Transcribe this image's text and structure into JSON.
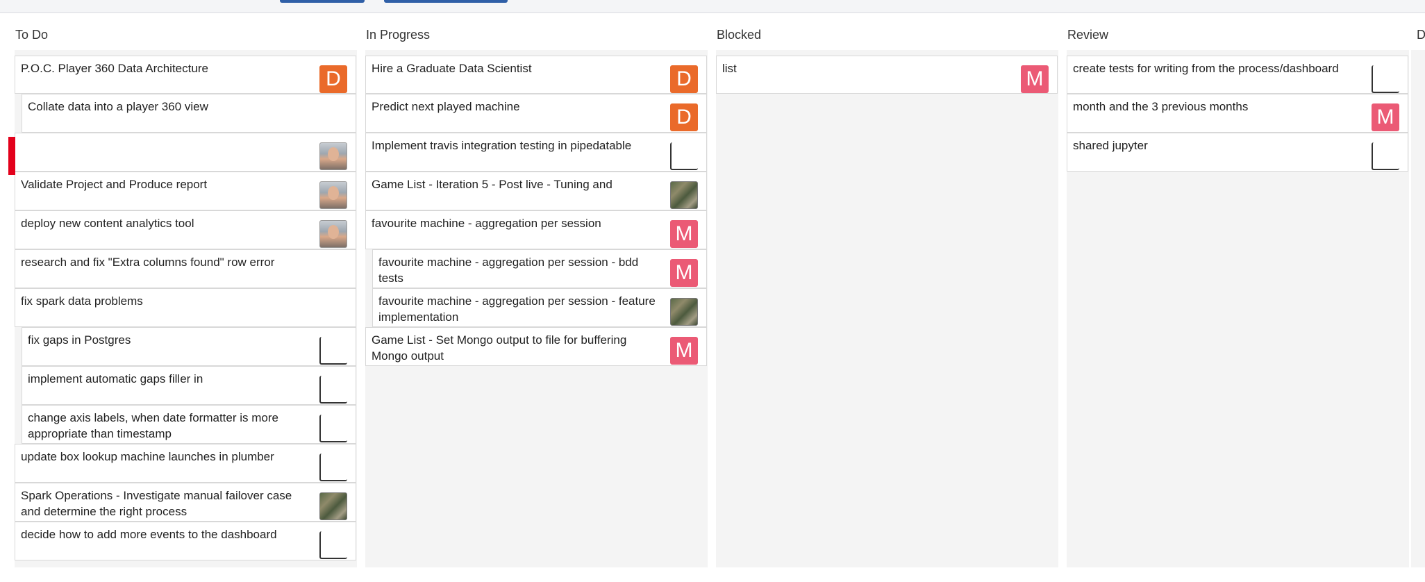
{
  "board": {
    "columns": [
      {
        "title": "To Do",
        "cards": [
          {
            "title": "P.O.C. Player 360 Data Architecture",
            "avatar": "D",
            "avatar_type": "letter-orange"
          },
          {
            "title": "Collate data into a player 360 view",
            "avatar": "",
            "avatar_type": "none"
          },
          {
            "title": "",
            "avatar": "",
            "avatar_type": "photo"
          },
          {
            "title": "Validate Project and Produce report",
            "avatar": "",
            "avatar_type": "photo"
          },
          {
            "title": "deploy new content analytics tool",
            "avatar": "",
            "avatar_type": "photo"
          },
          {
            "title": "research and fix \"Extra columns found\" row error",
            "avatar": "",
            "avatar_type": "none"
          },
          {
            "title": "fix spark data problems",
            "avatar": "",
            "avatar_type": "none"
          },
          {
            "title": "fix gaps in Postgres",
            "avatar": "",
            "avatar_type": "partial"
          },
          {
            "title": "implement automatic gaps filler in",
            "avatar": "",
            "avatar_type": "partial"
          },
          {
            "title": "change axis labels, when date formatter is more appropriate than timestamp",
            "avatar": "",
            "avatar_type": "partial"
          },
          {
            "title": "update box lookup machine launches in plumber",
            "avatar": "",
            "avatar_type": "partial"
          },
          {
            "title": "Spark Operations - Investigate manual failover case and determine the right process",
            "avatar": "",
            "avatar_type": "tile"
          },
          {
            "title": "decide how to add more events to the dashboard",
            "avatar": "",
            "avatar_type": "partial"
          }
        ]
      },
      {
        "title": "In Progress",
        "cards": [
          {
            "title": "Hire a Graduate Data Scientist",
            "avatar": "D",
            "avatar_type": "letter-orange"
          },
          {
            "title": "Predict next played machine",
            "avatar": "D",
            "avatar_type": "letter-orange"
          },
          {
            "title": "Implement travis integration testing in pipedatable",
            "avatar": "",
            "avatar_type": "partial"
          },
          {
            "title": "Game List - Iteration 5 - Post live - Tuning and",
            "avatar": "",
            "avatar_type": "tile"
          },
          {
            "title": "favourite machine - aggregation per session",
            "avatar": "M",
            "avatar_type": "letter-pink"
          },
          {
            "title": "favourite machine - aggregation per session - bdd tests",
            "avatar": "M",
            "avatar_type": "letter-pink"
          },
          {
            "title": "favourite machine - aggregation per session - feature implementation",
            "avatar": "",
            "avatar_type": "tile"
          },
          {
            "title": "Game List - Set Mongo output to file for buffering Mongo output",
            "avatar": "M",
            "avatar_type": "letter-pink"
          }
        ]
      },
      {
        "title": "Blocked",
        "cards": [
          {
            "title": "list",
            "avatar": "M",
            "avatar_type": "letter-pink"
          }
        ]
      },
      {
        "title": "Review",
        "cards": [
          {
            "title": "create tests for writing from the process/dashboard",
            "avatar": "",
            "avatar_type": "partial"
          },
          {
            "title": "month and the 3 previous months",
            "avatar": "M",
            "avatar_type": "letter-pink"
          },
          {
            "title": "shared jupyter",
            "avatar": "",
            "avatar_type": "partial"
          }
        ]
      },
      {
        "title": "D",
        "cards": []
      }
    ]
  }
}
